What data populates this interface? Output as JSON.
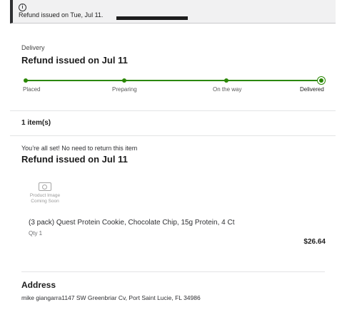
{
  "banner": {
    "message": "Refund issued on Tue, Jul 11."
  },
  "delivery": {
    "section_label": "Delivery",
    "title": "Refund issued on Jul 11",
    "steps": [
      "Placed",
      "Preparing",
      "On the way",
      "Delivered"
    ]
  },
  "items": {
    "count_label": "1 item(s)",
    "note": "You’re all set! No need to return this item",
    "title": "Refund issued on Jul 11",
    "product": {
      "image_placeholder_line1": "Product Image",
      "image_placeholder_line2": "Coming Soon",
      "name": "(3 pack) Quest Protein Cookie, Chocolate Chip, 15g Protein, 4 Ct",
      "qty": "Qty 1",
      "price": "$26.64"
    }
  },
  "address": {
    "heading": "Address",
    "line": "mike giangarra1147 SW Greenbriar Cv, Port Saint Lucie, FL 34986"
  },
  "colors": {
    "accent": "#2a8703",
    "banner_bg": "#f1f1f2"
  }
}
